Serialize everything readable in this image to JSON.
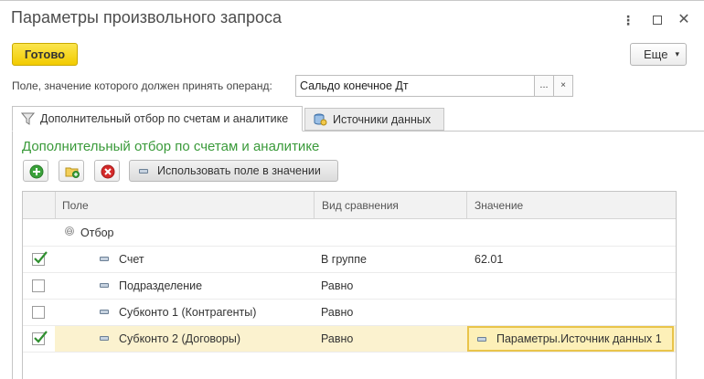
{
  "window": {
    "title": "Параметры произвольного запроса",
    "controls": {
      "more": "⋮",
      "close": "✕"
    }
  },
  "toolbar": {
    "done_label": "Готово",
    "more_label": "Еще",
    "more_arrow": "▾"
  },
  "operand_field": {
    "label": "Поле, значение которого должен принять операнд:",
    "value": "Сальдо конечное Дт",
    "select_button": "...",
    "clear_button": "×"
  },
  "tabs": [
    {
      "label": "Дополнительный отбор по счетам и аналитике",
      "active": true,
      "icon": "filter-icon"
    },
    {
      "label": "Источники данных",
      "active": false,
      "icon": "data-sources-icon"
    }
  ],
  "filter_panel": {
    "title": "Дополнительный отбор по счетам и аналитике",
    "use_field_button": "Использовать поле в значении",
    "colors": {
      "title": "#3a9a3a",
      "add": "#3aa13a",
      "delete": "#d42a2a"
    }
  },
  "grid": {
    "columns": [
      "Поле",
      "Вид сравнения",
      "Значение"
    ],
    "group": {
      "label": "Отбор",
      "expander": "⊖"
    },
    "rows": [
      {
        "checked": true,
        "field": "Счет",
        "comparison": "В группе",
        "value": "62.01"
      },
      {
        "checked": false,
        "field": "Подразделение",
        "comparison": "Равно",
        "value": ""
      },
      {
        "checked": false,
        "field": "Субконто 1 (Контрагенты)",
        "comparison": "Равно",
        "value": ""
      },
      {
        "checked": true,
        "field": "Субконто 2 (Договоры)",
        "comparison": "Равно",
        "value": "Параметры.Источник данных 1",
        "selected": true
      }
    ]
  }
}
